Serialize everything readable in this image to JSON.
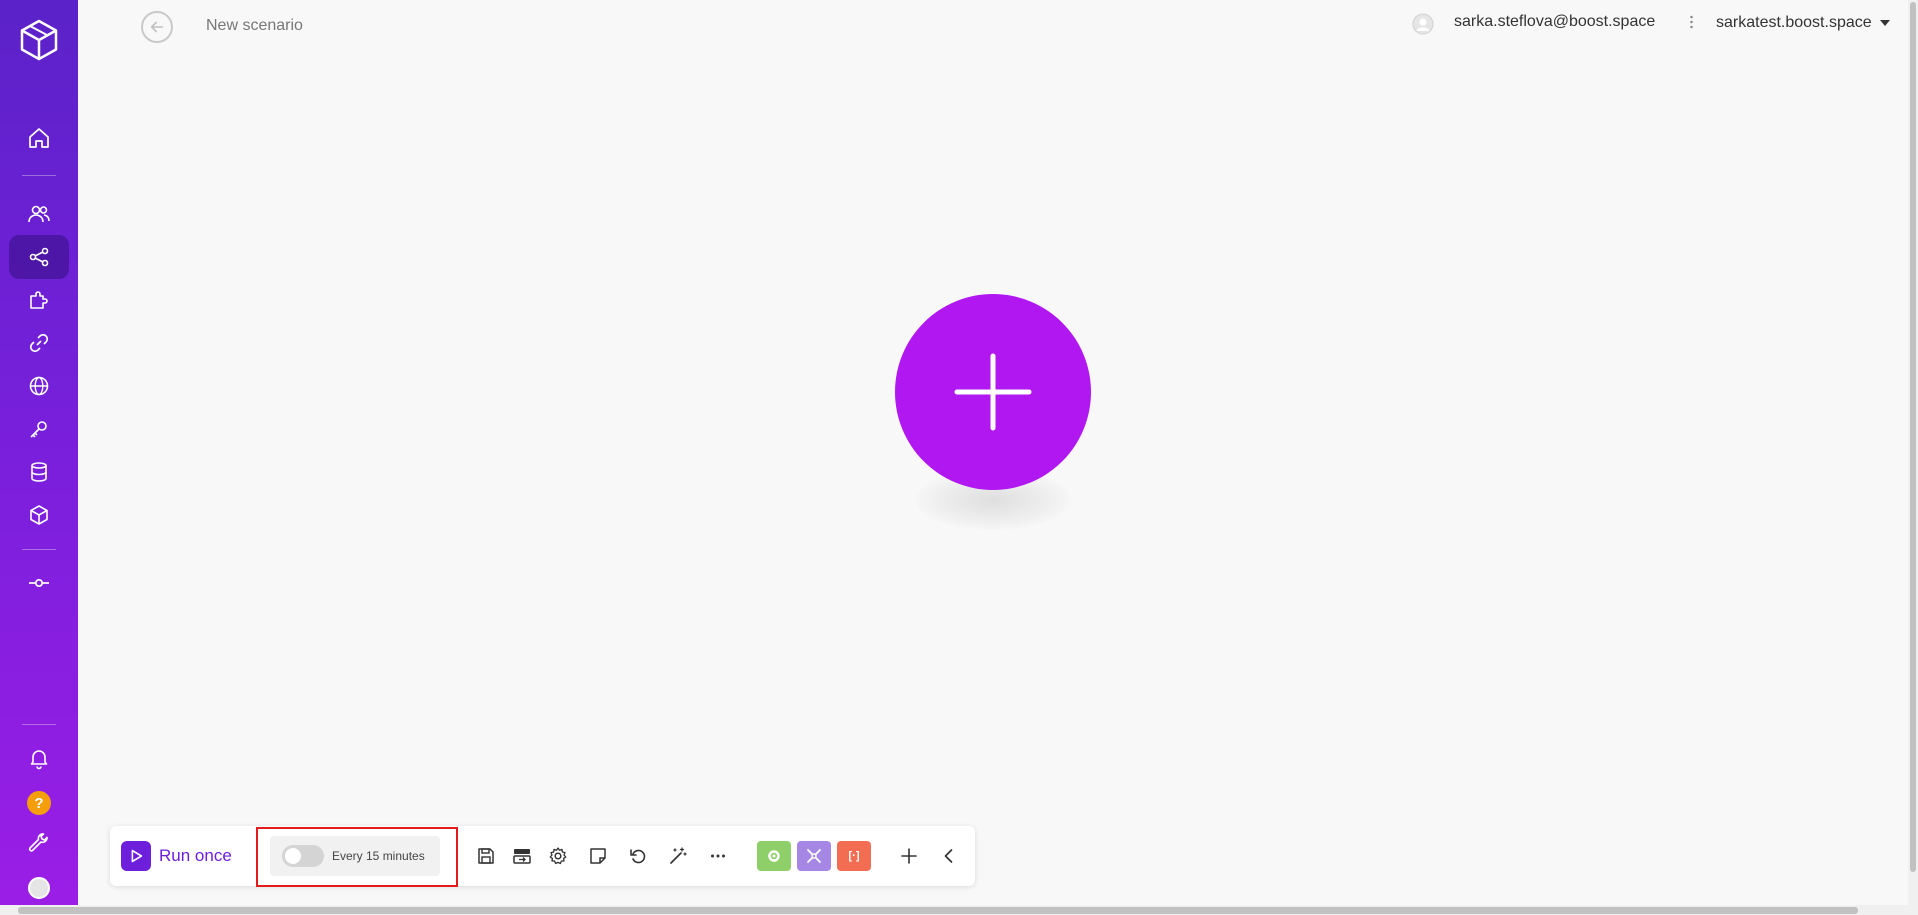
{
  "header": {
    "scenario_title": "New scenario",
    "user_email": "sarka.steflova@boost.space",
    "org_name": "sarkatest.boost.space"
  },
  "sidebar": {
    "items": [
      {
        "name": "home-icon",
        "active": false
      },
      {
        "name": "users-icon",
        "active": false
      },
      {
        "name": "share-icon",
        "active": true
      },
      {
        "name": "puzzle-icon",
        "active": false
      },
      {
        "name": "link-icon",
        "active": false
      },
      {
        "name": "globe-icon",
        "active": false
      },
      {
        "name": "key-icon",
        "active": false
      },
      {
        "name": "database-icon",
        "active": false
      },
      {
        "name": "cube-icon",
        "active": false
      },
      {
        "name": "commit-icon",
        "active": false
      },
      {
        "name": "bell-icon",
        "active": false
      },
      {
        "name": "help-icon",
        "active": false
      },
      {
        "name": "wrench-icon",
        "active": false
      },
      {
        "name": "avatar",
        "active": false
      }
    ],
    "help_glyph": "?"
  },
  "canvas": {
    "add_module_icon": "plus-icon"
  },
  "toolbar": {
    "run_once_label": "Run once",
    "schedule_label": "Every 15 minutes",
    "schedule_enabled": false,
    "tools": [
      "save-icon",
      "auto-align-icon",
      "settings-icon",
      "note-icon",
      "undo-icon",
      "magic-wand-icon",
      "more-icon"
    ],
    "color_buttons": [
      {
        "name": "tools-button",
        "color": "#8fcf6a"
      },
      {
        "name": "flow-control-button",
        "color": "#a787e6"
      },
      {
        "name": "text-parser-button",
        "color": "#f26d52",
        "label": "[·]"
      }
    ]
  },
  "colors": {
    "accent": "#b117f0",
    "run_once": "#6d1fdc",
    "highlight": "#e31b1b"
  }
}
